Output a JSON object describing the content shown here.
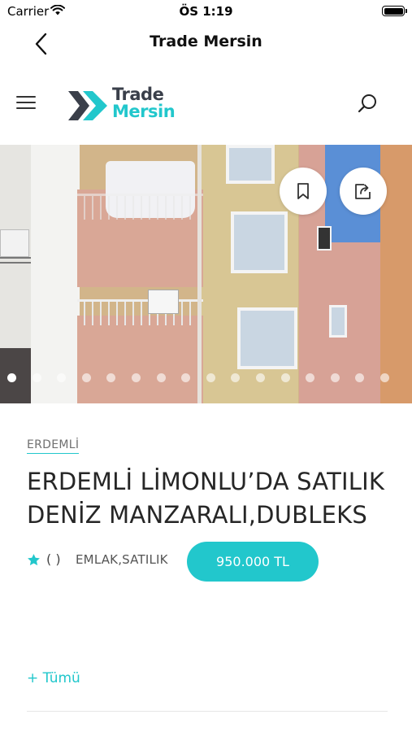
{
  "status_bar": {
    "carrier": "Carrier",
    "time": "ÖS 1:19"
  },
  "navbar": {
    "title": "Trade Mersin",
    "back_icon": "chevron-left-icon"
  },
  "header": {
    "menu_icon": "hamburger-menu-icon",
    "logo_line1": "Trade",
    "logo_line2": "Mersin",
    "search_icon": "search-icon"
  },
  "gallery": {
    "bookmark_icon": "bookmark-icon",
    "share_icon": "share-icon",
    "total_photos": 16,
    "active_photo": 1
  },
  "listing": {
    "district": "ERDEMLİ",
    "title": "ERDEMLİ LİMONLU’DA SATILIK DENİZ MANZARALI,DUBLEKS",
    "rating_text": "( )",
    "category": "EMLAK,SATILIK",
    "price": "950.000 TL",
    "more_link": "+ Tümü"
  },
  "colors": {
    "accent": "#22c7cc",
    "logo_dark": "#3a3f4a"
  }
}
